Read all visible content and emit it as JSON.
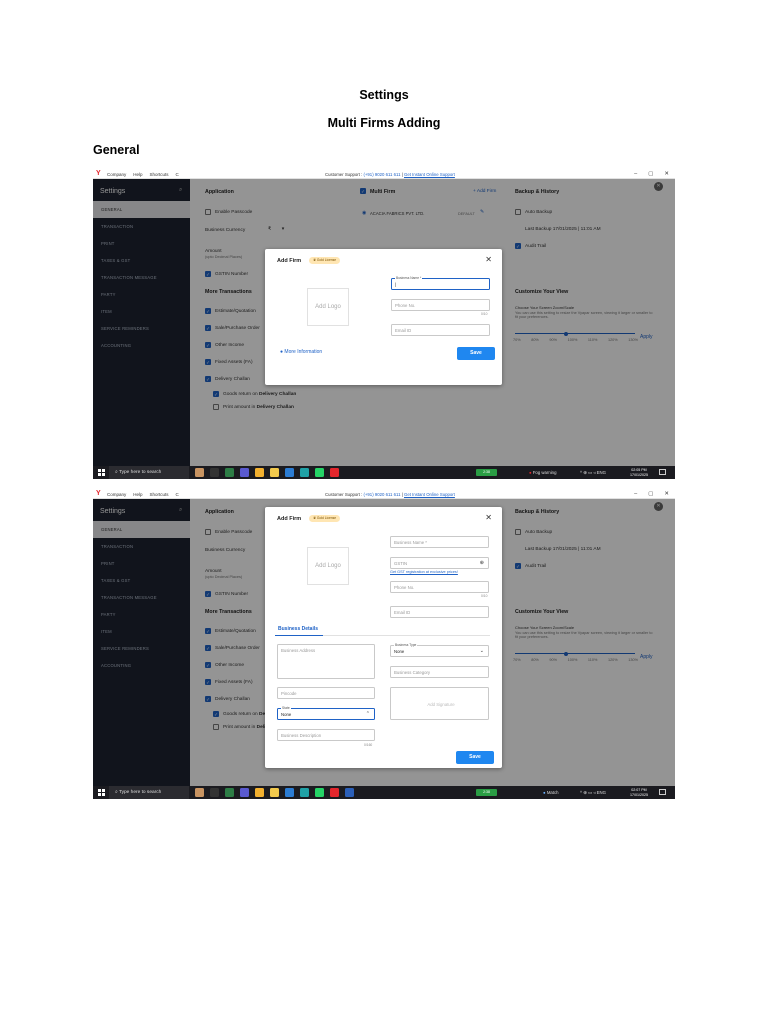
{
  "document": {
    "title": "Settings",
    "subtitle": "Multi Firms Adding",
    "section": "General"
  },
  "app": {
    "logo": "Y",
    "menu": [
      "Company",
      "Help",
      "Shortcuts",
      "C"
    ],
    "support_label": "Customer Support :",
    "support_phone": "(+91) 9020 611 611",
    "support_sep": "|",
    "support_link": "Get Instant Online Support",
    "window_controls": [
      "–",
      "▢",
      "✕"
    ]
  },
  "sidebar": {
    "header": "Settings",
    "items": [
      "GENERAL",
      "TRANSACTION",
      "PRINT",
      "TAXES & GST",
      "TRANSACTION MESSAGE",
      "PARTY",
      "ITEM",
      "SERVICE REMINDERS",
      "ACCOUNTING"
    ]
  },
  "application": {
    "title": "Application",
    "enable_passcode": "Enable Passcode",
    "business_currency": "Business Currency",
    "currency_symbol": "₹",
    "amount": "Amount",
    "amount_sub": "(upto Decimal Places)",
    "gstin_number": "GSTIN Number",
    "more_transactions": "More Transactions",
    "transactions": [
      "Estimate/Quotation",
      "Sale/Purchase Order",
      "Other Income",
      "Fixed Assets (FA)",
      "Delivery Challan"
    ],
    "goods_return_prefix": "Goods return on",
    "goods_return_bold": "Delivery Challan",
    "print_amount_prefix": "Print amount in",
    "print_amount_bold": "Delivery Challan"
  },
  "multi_firm": {
    "title": "Multi Firm",
    "add_firm": "+ Add Firm",
    "firm_name": "ACACIA FABRICS PVT. LTD.",
    "firm_tag": "DEFAULT"
  },
  "backup": {
    "title": "Backup & History",
    "auto_backup": "Auto Backup",
    "last_backup": "Last Backup 17/01/2025 | 11:01 AM",
    "audit_trail": "Audit Trail"
  },
  "customize": {
    "title": "Customize Your View",
    "subtitle": "Choose Your Screen Zoom/Scale",
    "desc": "You can use this setting to resize the Vyapar screen, viewing it larger or smaller to fit your preferences.",
    "zoom_levels": [
      "70%",
      "80%",
      "90%",
      "100%",
      "110%",
      "120%",
      "130%"
    ],
    "apply": "Apply",
    "zoom_value": 100
  },
  "add_firm_modal_1": {
    "title": "Add Firm",
    "badge": "Gold License",
    "logo_placeholder": "Add Logo",
    "business_name_label": "Business Name *",
    "phone_placeholder": "Phone No.",
    "phone_count": "0/10",
    "email_placeholder": "Email ID",
    "more_info": "More Information",
    "save": "Save"
  },
  "add_firm_modal_2": {
    "title": "Add Firm",
    "badge": "Gold License",
    "logo_placeholder": "Add Logo",
    "business_name_placeholder": "Business Name *",
    "gstin_placeholder": "GSTIN",
    "gst_link": "Get GST registration at exclusive prices!",
    "phone_placeholder": "Phone No.",
    "phone_count": "0/10",
    "email_placeholder": "Email ID",
    "tab": "Business Details",
    "business_address_placeholder": "Business Address",
    "business_type_label": "Business Type",
    "business_type_value": "None",
    "business_category_placeholder": "Business Category",
    "pincode_placeholder": "Pincode",
    "state_label": "State",
    "state_value": "None",
    "signature_placeholder": "Add Signature",
    "description_placeholder": "Business Description",
    "description_count": "0/160",
    "save": "Save"
  },
  "taskbar_1": {
    "search": "Type here to search",
    "indicator": "2:38",
    "weather": "Fog warning",
    "tray": "^ ⊕ ▭ ◃ ENG",
    "time": "02:05 PM",
    "date": "17/01/2025"
  },
  "taskbar_2": {
    "search": "Type here to search",
    "indicator": "2:38",
    "weather": "Match",
    "tray": "^ ⊕ ▭ ◃ ENG",
    "time": "02:07 PM",
    "date": "17/01/2025"
  },
  "colors": {
    "accent": "#1f62c6",
    "sidebar": "#1e2431",
    "save_button": "#1f87f0",
    "badge": "#ffe6b3",
    "brand_red": "#e3262c"
  }
}
